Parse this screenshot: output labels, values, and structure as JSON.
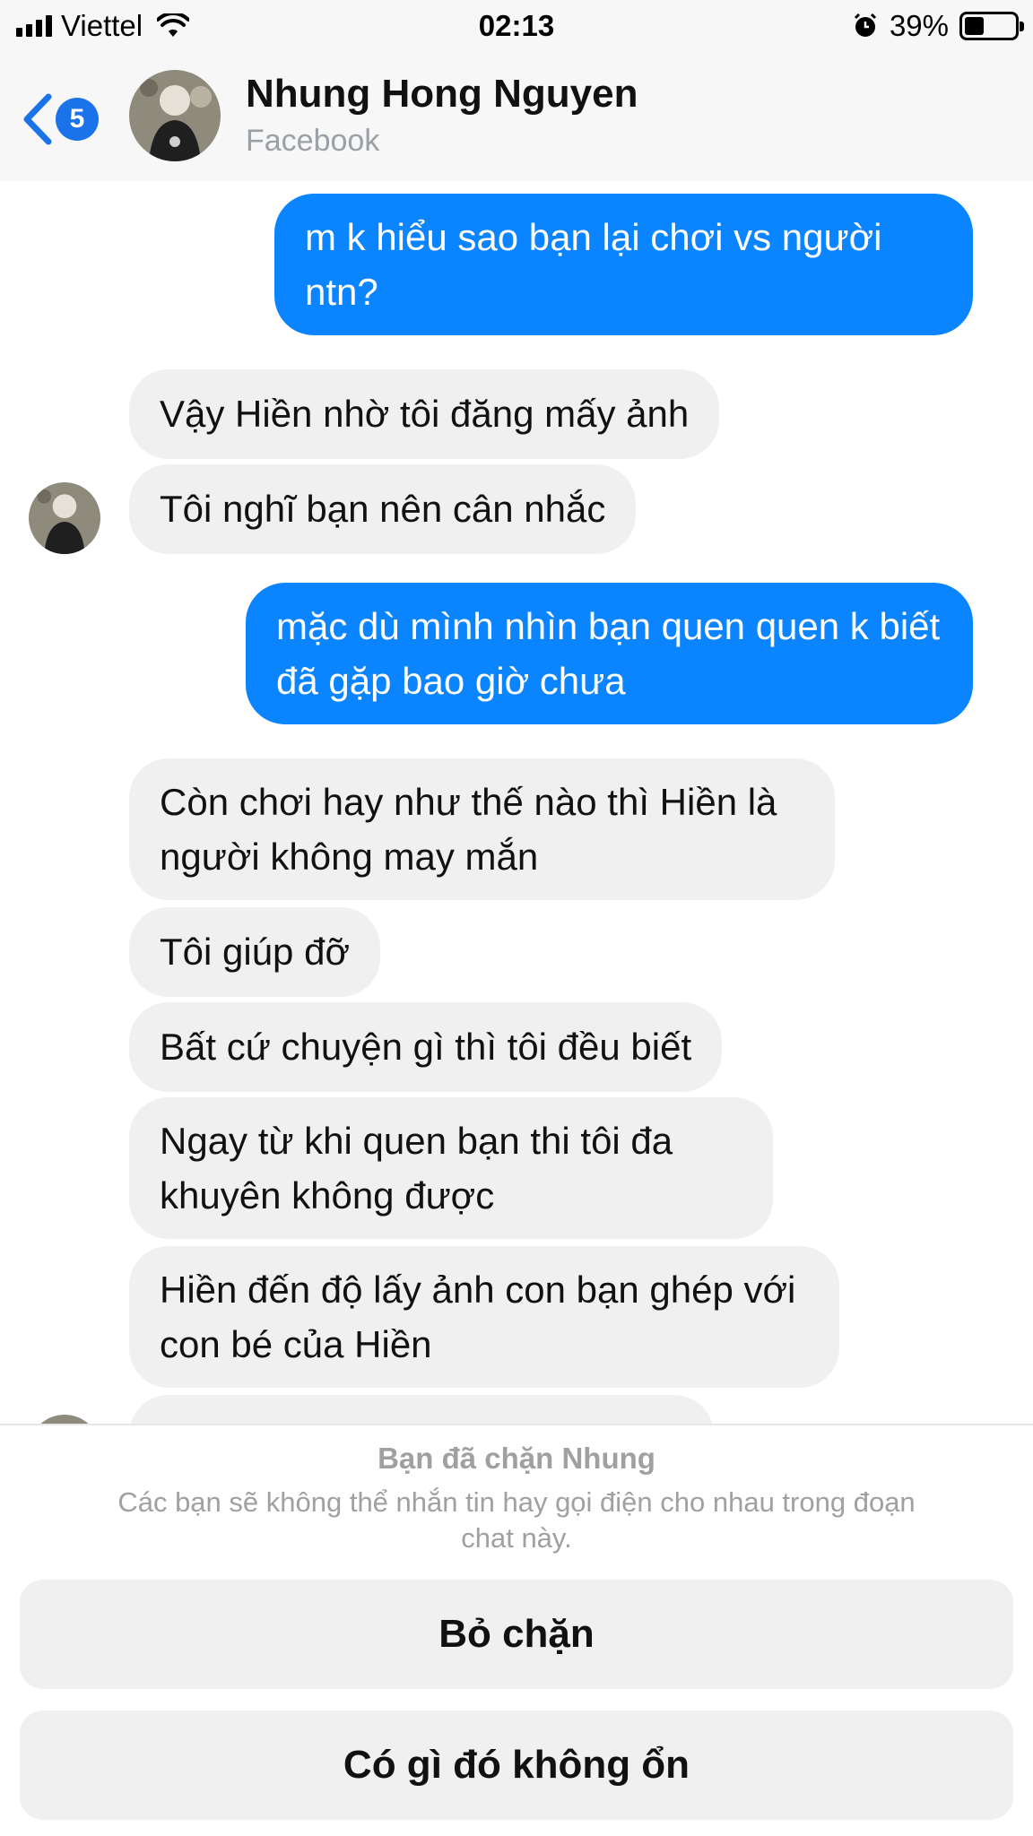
{
  "status_bar": {
    "carrier": "Viettel",
    "time": "02:13",
    "battery_percent": "39%",
    "battery_level": 0.39,
    "icons": [
      "signal-icon",
      "wifi-icon",
      "alarm-icon",
      "battery-icon"
    ]
  },
  "header": {
    "unread_count": "5",
    "contact_name": "Nhung Hong Nguyen",
    "contact_subtitle": "Facebook",
    "icons": [
      "back-chevron-icon"
    ]
  },
  "messages": [
    {
      "from": "me",
      "text": "m k hiểu sao bạn lại chơi vs người ntn?"
    },
    {
      "from": "them",
      "text": "Vậy Hiền nhờ tôi đăng mấy ảnh"
    },
    {
      "from": "them",
      "text": "Tôi nghĩ bạn nên cân nhắc"
    },
    {
      "from": "me",
      "text": "mặc dù mình nhìn bạn quen quen k biết đã gặp bao giờ chưa"
    },
    {
      "from": "them",
      "text": "Còn chơi hay như thế nào thì Hiền là người không may mắn"
    },
    {
      "from": "them",
      "text": "Tôi giúp đỡ"
    },
    {
      "from": "them",
      "text": "Bất cứ chuyện gì thì tôi đều biết"
    },
    {
      "from": "them",
      "text": "Ngay từ khi quen bạn thi tôi đa khuyên không được"
    },
    {
      "from": "them",
      "text": "Hiền đến độ lấy ảnh con bạn ghép với con bé của Hiền"
    }
  ],
  "blocked": {
    "title": "Bạn đã chặn Nhung",
    "description": "Các bạn sẽ không thể nhắn tin hay gọi điện cho nhau trong đoạn chat này.",
    "unblock_label": "Bỏ chặn",
    "report_label": "Có gì đó không ổn"
  },
  "colors": {
    "outgoing_bubble": "#0b84ff",
    "incoming_bubble": "#f0f0f0",
    "accent": "#1a73e8",
    "muted_text": "#a0a0a0"
  }
}
